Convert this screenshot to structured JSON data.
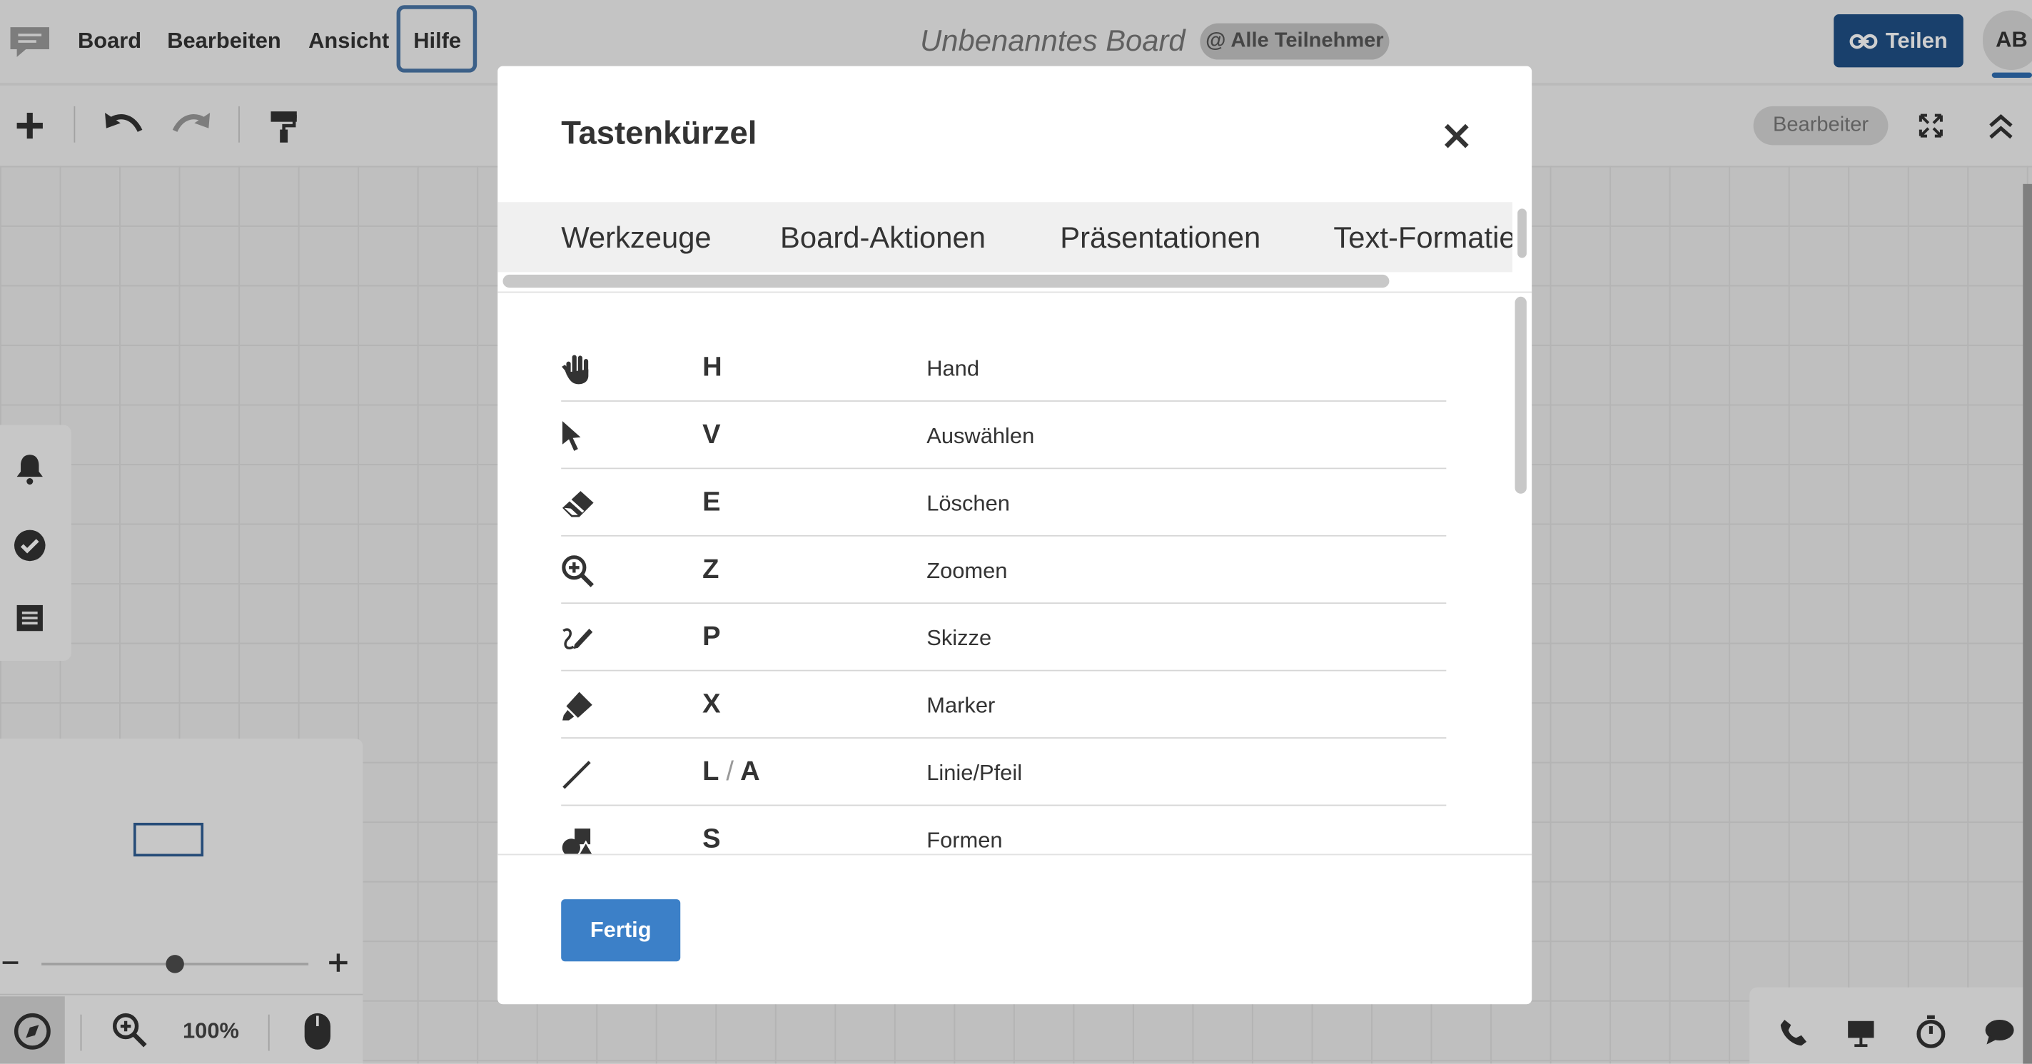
{
  "menu": {
    "items": [
      {
        "label": "Board"
      },
      {
        "label": "Bearbeiten"
      },
      {
        "label": "Ansicht"
      },
      {
        "label": "Hilfe"
      }
    ]
  },
  "header": {
    "board_title": "Unbenanntes Board",
    "participants_badge": "@ Alle Teilnehmer",
    "share_label": "Teilen",
    "avatar_initials": "AB"
  },
  "toolbar": {
    "role_chip": "Bearbeiter"
  },
  "minimap": {
    "zoom_level": "100%"
  },
  "modal": {
    "title": "Tastenkürzel",
    "tabs": [
      {
        "label": "Werkzeuge"
      },
      {
        "label": "Board-Aktionen"
      },
      {
        "label": "Präsentationen"
      },
      {
        "label": "Text-Formatierung"
      }
    ],
    "shortcuts": [
      {
        "icon": "hand-icon",
        "key": "H",
        "label": "Hand"
      },
      {
        "icon": "select-pointer-icon",
        "key": "V",
        "label": "Auswählen"
      },
      {
        "icon": "eraser-icon",
        "key": "E",
        "label": "Löschen"
      },
      {
        "icon": "zoom-icon",
        "key": "Z",
        "label": "Zoomen"
      },
      {
        "icon": "sketch-pen-icon",
        "key": "P",
        "label": "Skizze"
      },
      {
        "icon": "marker-icon",
        "key": "X",
        "label": "Marker"
      },
      {
        "icon": "line-icon",
        "key_a": "L",
        "key_sep": "/",
        "key_b": "A",
        "label": "Linie/Pfeil"
      },
      {
        "icon": "shapes-icon",
        "key": "S",
        "label": "Formen"
      }
    ],
    "done_label": "Fertig"
  },
  "colors": {
    "accent": "#3c80c8",
    "share": "#1f4f86",
    "focus": "#4a77a8"
  }
}
